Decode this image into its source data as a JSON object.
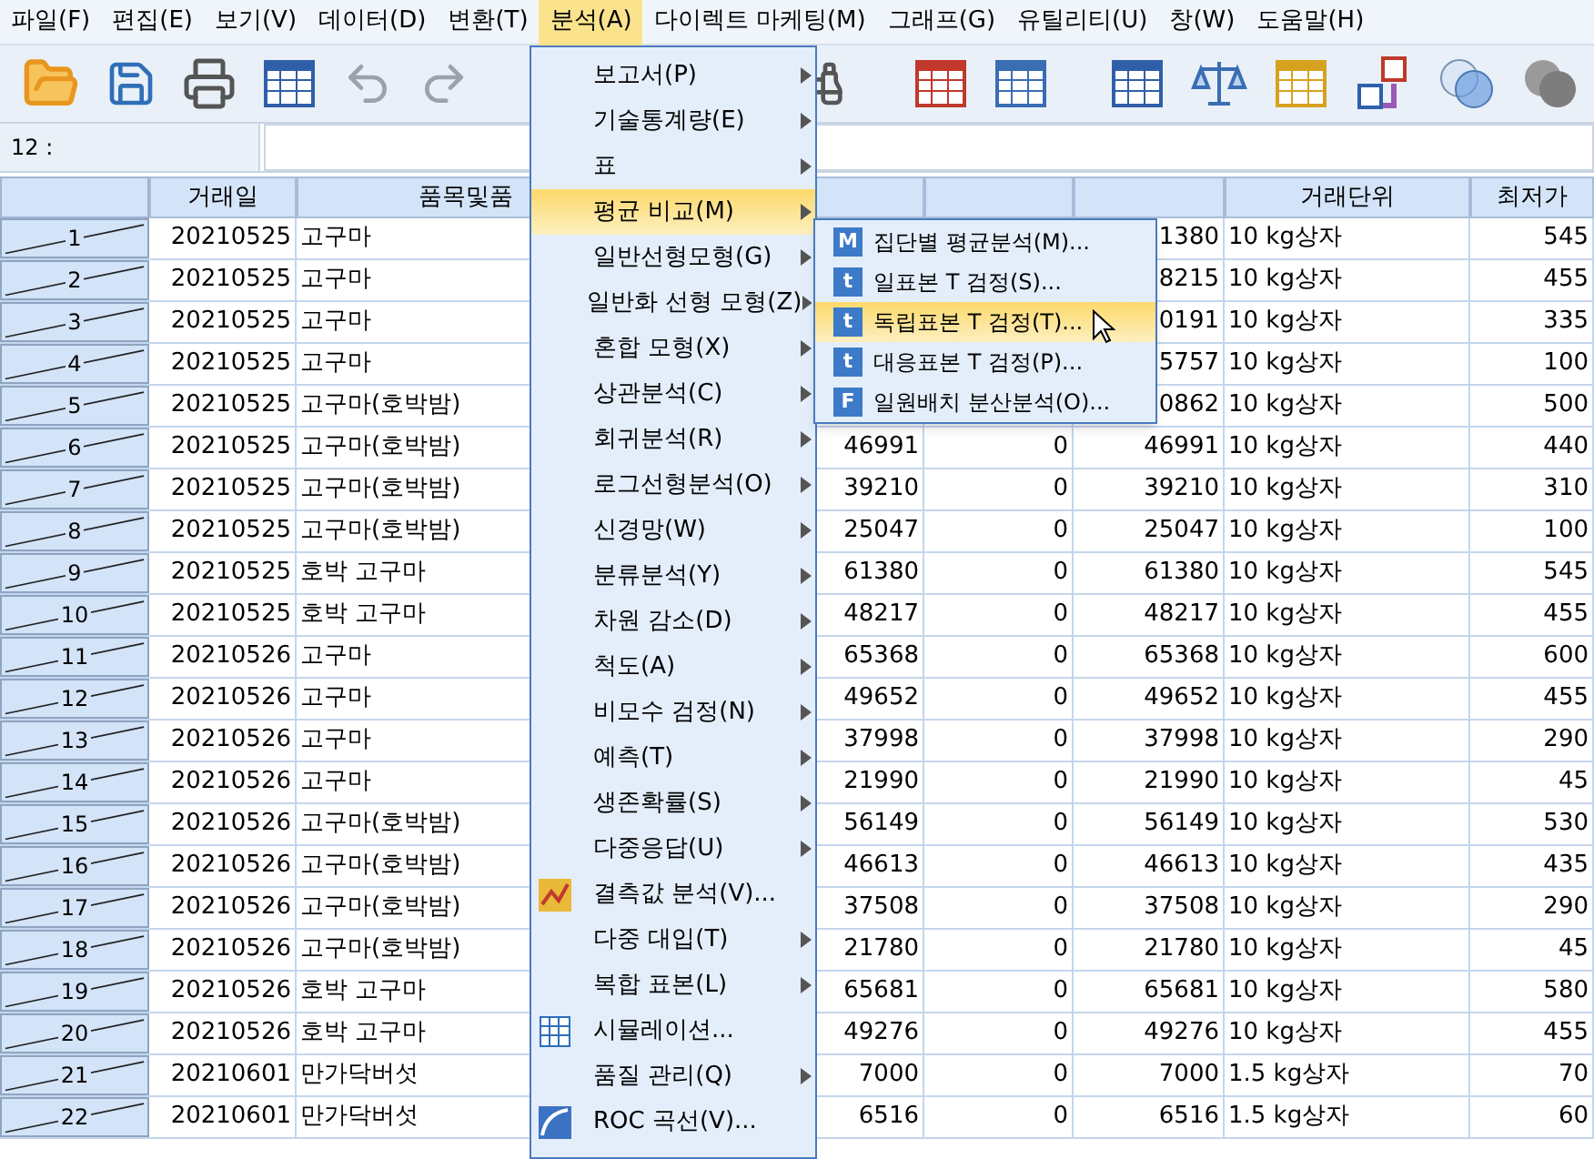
{
  "menu_bar": [
    {
      "label": "파일(F)",
      "selected": false
    },
    {
      "label": "편집(E)",
      "selected": false
    },
    {
      "label": "보기(V)",
      "selected": false
    },
    {
      "label": "데이터(D)",
      "selected": false
    },
    {
      "label": "변환(T)",
      "selected": false
    },
    {
      "label": "분석(A)",
      "selected": true
    },
    {
      "label": "다이렉트 마케팅(M)",
      "selected": false
    },
    {
      "label": "그래프(G)",
      "selected": false
    },
    {
      "label": "유틸리티(U)",
      "selected": false
    },
    {
      "label": "창(W)",
      "selected": false
    },
    {
      "label": "도움말(H)",
      "selected": false
    }
  ],
  "cell_reference": {
    "label": "12 :"
  },
  "table": {
    "columns": [
      "거래일",
      "품목및품",
      "",
      "",
      "",
      "거래단위",
      "최저가"
    ],
    "rows": [
      {
        "row": "1",
        "filtered_out": true,
        "cells": [
          "20210525",
          "고구마",
          "",
          "",
          "1380",
          "10 kg상자",
          "545"
        ]
      },
      {
        "row": "2",
        "filtered_out": true,
        "cells": [
          "20210525",
          "고구마",
          "",
          "",
          "8215",
          "10 kg상자",
          "455"
        ]
      },
      {
        "row": "3",
        "filtered_out": true,
        "cells": [
          "20210525",
          "고구마",
          "",
          "",
          "0191",
          "10 kg상자",
          "335"
        ]
      },
      {
        "row": "4",
        "filtered_out": true,
        "cells": [
          "20210525",
          "고구마",
          "",
          "",
          "5757",
          "10 kg상자",
          "100"
        ]
      },
      {
        "row": "5",
        "filtered_out": true,
        "cells": [
          "20210525",
          "고구마(호박밤)",
          "",
          "",
          "0862",
          "10 kg상자",
          "500"
        ]
      },
      {
        "row": "6",
        "filtered_out": true,
        "cells": [
          "20210525",
          "고구마(호박밤)",
          "46991",
          "0",
          "46991",
          "10 kg상자",
          "440"
        ]
      },
      {
        "row": "7",
        "filtered_out": true,
        "cells": [
          "20210525",
          "고구마(호박밤)",
          "39210",
          "0",
          "39210",
          "10 kg상자",
          "310"
        ]
      },
      {
        "row": "8",
        "filtered_out": true,
        "cells": [
          "20210525",
          "고구마(호박밤)",
          "25047",
          "0",
          "25047",
          "10 kg상자",
          "100"
        ]
      },
      {
        "row": "9",
        "filtered_out": true,
        "cells": [
          "20210525",
          "호박 고구마",
          "61380",
          "0",
          "61380",
          "10 kg상자",
          "545"
        ]
      },
      {
        "row": "10",
        "filtered_out": true,
        "cells": [
          "20210525",
          "호박 고구마",
          "48217",
          "0",
          "48217",
          "10 kg상자",
          "455"
        ]
      },
      {
        "row": "11",
        "filtered_out": true,
        "cells": [
          "20210526",
          "고구마",
          "65368",
          "0",
          "65368",
          "10 kg상자",
          "600"
        ]
      },
      {
        "row": "12",
        "filtered_out": true,
        "cells": [
          "20210526",
          "고구마",
          "49652",
          "0",
          "49652",
          "10 kg상자",
          "455"
        ]
      },
      {
        "row": "13",
        "filtered_out": true,
        "cells": [
          "20210526",
          "고구마",
          "37998",
          "0",
          "37998",
          "10 kg상자",
          "290"
        ]
      },
      {
        "row": "14",
        "filtered_out": true,
        "cells": [
          "20210526",
          "고구마",
          "21990",
          "0",
          "21990",
          "10 kg상자",
          "45"
        ]
      },
      {
        "row": "15",
        "filtered_out": true,
        "cells": [
          "20210526",
          "고구마(호박밤)",
          "56149",
          "0",
          "56149",
          "10 kg상자",
          "530"
        ]
      },
      {
        "row": "16",
        "filtered_out": true,
        "cells": [
          "20210526",
          "고구마(호박밤)",
          "46613",
          "0",
          "46613",
          "10 kg상자",
          "435"
        ]
      },
      {
        "row": "17",
        "filtered_out": true,
        "cells": [
          "20210526",
          "고구마(호박밤)",
          "37508",
          "0",
          "37508",
          "10 kg상자",
          "290"
        ]
      },
      {
        "row": "18",
        "filtered_out": true,
        "cells": [
          "20210526",
          "고구마(호박밤)",
          "21780",
          "0",
          "21780",
          "10 kg상자",
          "45"
        ]
      },
      {
        "row": "19",
        "filtered_out": true,
        "cells": [
          "20210526",
          "호박 고구마",
          "65681",
          "0",
          "65681",
          "10 kg상자",
          "580"
        ]
      },
      {
        "row": "20",
        "filtered_out": true,
        "cells": [
          "20210526",
          "호박 고구마",
          "49276",
          "0",
          "49276",
          "10 kg상자",
          "455"
        ]
      },
      {
        "row": "21",
        "filtered_out": true,
        "cells": [
          "20210601",
          "만가닥버섯",
          "7000",
          "0",
          "7000",
          "1.5 kg상자",
          "70"
        ]
      },
      {
        "row": "22",
        "filtered_out": true,
        "cells": [
          "20210601",
          "만가닥버섯",
          "6516",
          "0",
          "6516",
          "1.5 kg상자",
          "60"
        ]
      }
    ]
  },
  "analyze_menu": [
    {
      "label": "보고서(P)",
      "kind": "submenu",
      "selected": false
    },
    {
      "label": "기술통계량(E)",
      "kind": "submenu",
      "selected": false
    },
    {
      "label": "표",
      "kind": "submenu",
      "selected": false
    },
    {
      "label": "평균 비교(M)",
      "kind": "submenu",
      "selected": true
    },
    {
      "label": "일반선형모형(G)",
      "kind": "submenu",
      "selected": false
    },
    {
      "label": "일반화 선형 모형(Z)",
      "kind": "submenu",
      "selected": false
    },
    {
      "label": "혼합 모형(X)",
      "kind": "submenu",
      "selected": false
    },
    {
      "label": "상관분석(C)",
      "kind": "submenu",
      "selected": false
    },
    {
      "label": "회귀분석(R)",
      "kind": "submenu",
      "selected": false
    },
    {
      "label": "로그선형분석(O)",
      "kind": "submenu",
      "selected": false
    },
    {
      "label": "신경망(W)",
      "kind": "submenu",
      "selected": false
    },
    {
      "label": "분류분석(Y)",
      "kind": "submenu",
      "selected": false
    },
    {
      "label": "차원 감소(D)",
      "kind": "submenu",
      "selected": false
    },
    {
      "label": "척도(A)",
      "kind": "submenu",
      "selected": false
    },
    {
      "label": "비모수 검정(N)",
      "kind": "submenu",
      "selected": false
    },
    {
      "label": "예측(T)",
      "kind": "submenu",
      "selected": false
    },
    {
      "label": "생존확률(S)",
      "kind": "submenu",
      "selected": false
    },
    {
      "label": "다중응답(U)",
      "kind": "submenu",
      "selected": false
    },
    {
      "label": "결측값 분석(V)...",
      "kind": "missing",
      "selected": false
    },
    {
      "label": "다중 대입(T)",
      "kind": "submenu",
      "selected": false
    },
    {
      "label": "복합 표본(L)",
      "kind": "submenu",
      "selected": false
    },
    {
      "label": "시뮬레이션...",
      "kind": "simulation",
      "selected": false
    },
    {
      "label": "품질 관리(Q)",
      "kind": "submenu",
      "selected": false
    },
    {
      "label": "ROC 곡선(V)...",
      "kind": "roc",
      "selected": false
    }
  ],
  "compare_means_submenu": [
    {
      "label": "집단별 평균분석(M)...",
      "icon_text": "M",
      "selected": false
    },
    {
      "label": "일표본 T 검정(S)...",
      "icon_text": "t",
      "selected": false
    },
    {
      "label": "독립표본 T 검정(T)...",
      "icon_text": "t",
      "selected": true
    },
    {
      "label": "대응표본 T 검정(P)...",
      "icon_text": "t",
      "selected": false
    },
    {
      "label": "일원배치 분산분석(O)...",
      "icon_text": "F",
      "selected": false
    }
  ]
}
